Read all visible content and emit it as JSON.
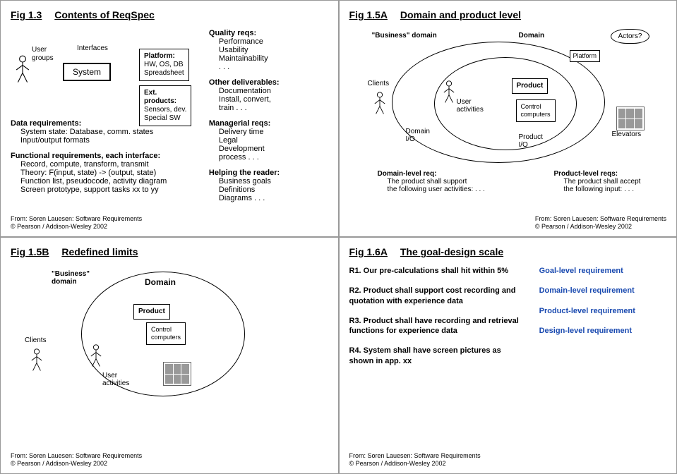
{
  "fig13": {
    "prefix": "Fig 1.3",
    "name": "Contents of ReqSpec",
    "user_groups": "User\ngroups",
    "interfaces": "Interfaces",
    "system": "System",
    "platform_h": "Platform:",
    "platform_b": "HW, OS, DB\nSpreadsheet",
    "ext_h": "Ext. products:",
    "ext_b": "Sensors, dev.\nSpecial SW",
    "data_h": "Data requirements:",
    "data_l1": "System state: Database, comm. states",
    "data_l2": "Input/output formats",
    "func_h": "Functional requirements, each interface:",
    "func_l1": "Record, compute, transform, transmit",
    "func_l2": "Theory: F(input, state) -> (output, state)",
    "func_l3": "Function list, pseudocode, activity diagram",
    "func_l4": "Screen prototype, support tasks xx to yy",
    "qual_h": "Quality reqs:",
    "qual_l1": "Performance",
    "qual_l2": "Usability",
    "qual_l3": "Maintainability",
    "qual_l4": ". . .",
    "other_h": "Other deliverables:",
    "other_l1": "Documentation",
    "other_l2": "Install, convert,",
    "other_l3": "train . . .",
    "mgr_h": "Managerial reqs:",
    "mgr_l1": "Delivery time",
    "mgr_l2": "Legal",
    "mgr_l3": "Development",
    "mgr_l4": "process . . .",
    "help_h": "Helping the reader:",
    "help_l1": "Business goals",
    "help_l2": "Definitions",
    "help_l3": "Diagrams . . .",
    "credit1": "From: Soren Lauesen: Software Requirements",
    "credit2": "© Pearson / Addison-Wesley 2002"
  },
  "fig15a": {
    "prefix": "Fig 1.5A",
    "name": "Domain and product level",
    "biz_domain": "\"Business\" domain",
    "domain": "Domain",
    "actors": "Actors?",
    "platform": "Platform",
    "clients": "Clients",
    "user_act": "User\nactivities",
    "product": "Product",
    "control": "Control\ncomputers",
    "domain_io": "Domain\nI/O",
    "product_io": "Product\nI/O",
    "elevators": "Elevators",
    "dl_h": "Domain-level req:",
    "dl_l1": "The product shall support",
    "dl_l2": "the following user activities: . . .",
    "pl_h": "Product-level reqs:",
    "pl_l1": "The product shall accept",
    "pl_l2": "the following input: . . .",
    "credit1": "From: Soren Lauesen: Software Requirements",
    "credit2": "© Pearson / Addison-Wesley 2002"
  },
  "fig15b": {
    "prefix": "Fig 1.5B",
    "name": "Redefined limits",
    "biz_domain": "\"Business\"\ndomain",
    "domain": "Domain",
    "product": "Product",
    "control": "Control\ncomputers",
    "clients": "Clients",
    "user_act": "User\nactivities",
    "credit1": "From: Soren Lauesen: Software Requirements",
    "credit2": "© Pearson / Addison-Wesley 2002"
  },
  "fig16a": {
    "prefix": "Fig 1.6A",
    "name": "The goal-design scale",
    "r1": "R1. Our pre-calculations shall hit within 5%",
    "r1_lvl": "Goal-level requirement",
    "r2": "R2. Product shall support cost recording and quotation with experience data",
    "r2_lvl": "Domain-level requirement",
    "r3": "R3. Product shall have recording and retrieval functions for experience data",
    "r3_lvl": "Product-level requirement",
    "r4": "R4. System shall have screen pictures as shown in app. xx",
    "r4_lvl": "Design-level requirement",
    "credit1": "From: Soren Lauesen: Software Requirements",
    "credit2": "© Pearson / Addison-Wesley 2002"
  }
}
